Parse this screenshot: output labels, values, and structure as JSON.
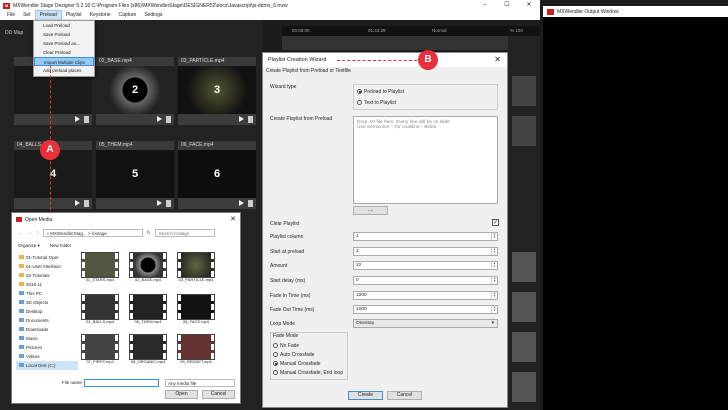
{
  "app": {
    "title": "MXWendler Stage Designer 5.2.16  C:\\Program Files (x86)\\MXWendlerStage\\DESIGNER52\\docs\\Javascript\\js-demo_6.mxw",
    "menu": [
      "File",
      "Set",
      "Preload",
      "Playlist",
      "Keystone",
      "Capture",
      "Settings"
    ]
  },
  "output_window": {
    "title": "MXWendler Output Window"
  },
  "set": {
    "map_label": "DD Map"
  },
  "transport": {
    "time1": "00:00:00",
    "time2": "01:43:29",
    "mode": "Normal",
    "percent": "% 100"
  },
  "preload_menu": {
    "items": [
      "Load Preload",
      "Save Preload",
      "Save Preload as...",
      "Clear Preload",
      "Import Multiple Clips",
      "Add preload places"
    ],
    "highlighted": "Import Multiple Clips"
  },
  "markers": {
    "a": "A",
    "b": "B"
  },
  "tiles": [
    {
      "name": "",
      "number": ""
    },
    {
      "name": "02_BASE.mp4",
      "number": "2"
    },
    {
      "name": "03_PARTICLE.mp4",
      "number": "3"
    },
    {
      "name": "04_BALLS.mp4",
      "number": "4"
    },
    {
      "name": "05_THEM.mp4",
      "number": "5"
    },
    {
      "name": "06_FACE.mp4",
      "number": "6"
    }
  ],
  "open_media": {
    "title": "Open Media",
    "path": "« MXWendlerStag... > footage",
    "search_placeholder": "Search footage",
    "organize": "Organize ▾",
    "new_folder": "New folder",
    "nav": [
      "01-Tutorial Oper",
      "01-User Interface",
      "02-Tutorials",
      "2018.11",
      "This PC",
      "3D Objects",
      "Desktop",
      "Documents",
      "Downloads",
      "Music",
      "Pictures",
      "Videos",
      "Local Disk (C:)"
    ],
    "files": [
      "01_STARS.mp4",
      "02_BASE.mp4",
      "03_PARTICLE.mp4",
      "04_BALLS.mp4",
      "05_THEM.mp4",
      "06_FACE.mp4",
      "07_PIPES.mp4",
      "08_ORGANIC.mp4",
      "09_REDNET.mp4"
    ],
    "file_name_label": "File name:",
    "file_type": "Any media file",
    "open": "Open",
    "cancel": "Cancel"
  },
  "wizard": {
    "title": "Playlist Creation Wizard",
    "subtitle": "Create Playlist from Preload or Textfile",
    "wizard_type_label": "Wizard type",
    "option_preload": "Preload to Playlist",
    "option_text": "Text to Playlist",
    "from_preload_label": "Create Playlist from Preload",
    "drop_hint": "Drop .txt file here. Every line will be on slide.\nUse Semicolon ';' for multiline - slides.",
    "dots_button": "....",
    "clear_playlist_label": "Clear Playlist",
    "clear_playlist_checked": true,
    "fields": [
      {
        "label": "Playlist column",
        "value": "1"
      },
      {
        "label": "Start at preload",
        "value": "1"
      },
      {
        "label": "Amount",
        "value": "22"
      },
      {
        "label": "Start delay (ms)",
        "value": "0"
      },
      {
        "label": "Fade In Time (ms)",
        "value": "1000"
      },
      {
        "label": "Fade Out Time (ms)",
        "value": "1000"
      }
    ],
    "loop_mode_label": "Loop Mode",
    "loop_mode_value": "Onestop",
    "fade_mode_label": "Fade Mode",
    "fade_options": [
      "No Fade",
      "Auto Crossfade",
      "Manual Crossfade",
      "Manual Crossfade, End loop"
    ],
    "fade_selected": "Manual Crossfade",
    "create": "Create",
    "cancel": "Cancel"
  }
}
